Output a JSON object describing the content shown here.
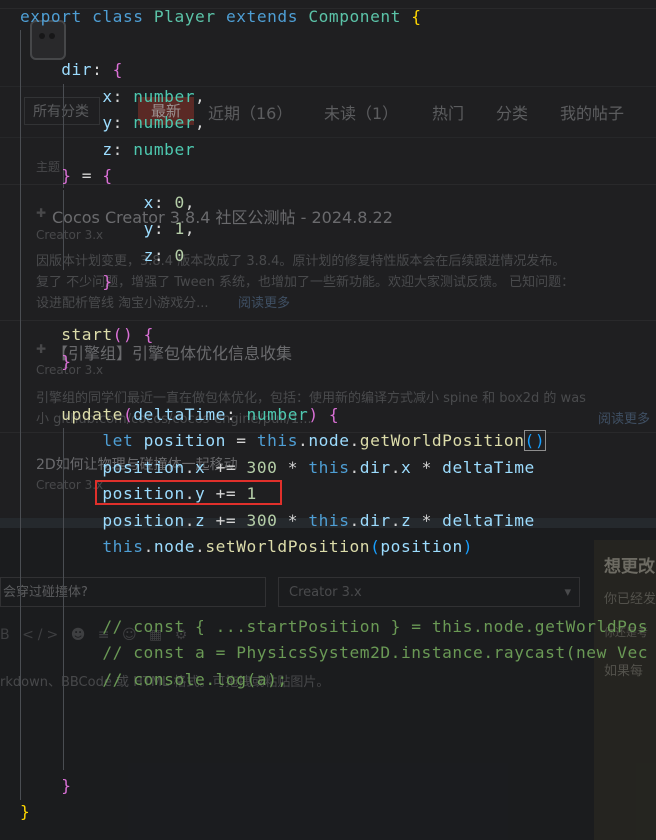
{
  "forum": {
    "category_select": "所有分类",
    "nav": {
      "latest": "最新",
      "recent": "近期（16）",
      "unread": "未读（1）",
      "hot": "热门",
      "categories": "分类",
      "my_posts": "我的帖子"
    },
    "topic_label": "主题",
    "topics": [
      {
        "title": "Cocos Creator 3.8.4 社区公测帖 - 2024.8.22",
        "tag": "Creator 3.x",
        "excerpt_1": "因版本计划变更，3.8.4 版本改成了 3.8.4。原计划的修复特性版本会在后续跟进情况发布。",
        "excerpt_2": "复了 不少问题，增强了 Tween 系统，也增加了一些新功能。欢迎大家测试反馈。 已知问题：",
        "excerpt_3": "设进配析管线 淘宝小游戏分...",
        "read_more": "阅读更多"
      },
      {
        "title": "【引擎组】引擎包体优化信息收集",
        "tag": "Creator 3.x",
        "excerpt_1": "引擎组的同学们最近一直在做包体优化，包括：使用新的编译方式减小 spine 和 box2d 的 was",
        "excerpt_2": "小 github.com/cocos/cocos-engine/pull/1...",
        "read_more": "阅读更多"
      },
      {
        "title": "2D如何让物理与碰撞体一起移动",
        "tag": "Creator 3.x"
      }
    ],
    "composer": {
      "title_value": "会穿过碰撞体?",
      "tag_value": "Creator 3.x",
      "hint": "rkdown、BBCode 或 HTML 格式。可拖拽或粘贴图片。",
      "toolbar_icons": [
        "bold-icon",
        "code-icon",
        "person-icon",
        "list-icon",
        "emoji-icon",
        "calendar-icon",
        "gear-icon"
      ]
    },
    "side": {
      "title": "想更改",
      "line_1": "你已经发",
      "line_2": "你还是考",
      "line_3": "如果每"
    }
  },
  "editor": {
    "lines": [
      {
        "tokens": [
          [
            "kw",
            "export"
          ],
          [
            "op",
            " "
          ],
          [
            "kw",
            "class"
          ],
          [
            "op",
            " "
          ],
          [
            "cls",
            "Player"
          ],
          [
            "op",
            " "
          ],
          [
            "kw",
            "extends"
          ],
          [
            "op",
            " "
          ],
          [
            "cls",
            "Component"
          ],
          [
            "op",
            " "
          ],
          [
            "br",
            "{"
          ]
        ]
      },
      {
        "tokens": []
      },
      {
        "tokens": [
          [
            "op",
            "    "
          ],
          [
            "var",
            "dir"
          ],
          [
            "op",
            ": "
          ],
          [
            "pu",
            "{"
          ]
        ]
      },
      {
        "tokens": [
          [
            "op",
            "        "
          ],
          [
            "var",
            "x"
          ],
          [
            "op",
            ": "
          ],
          [
            "typ",
            "number"
          ],
          [
            "op",
            ","
          ]
        ]
      },
      {
        "tokens": [
          [
            "op",
            "        "
          ],
          [
            "var",
            "y"
          ],
          [
            "op",
            ": "
          ],
          [
            "typ",
            "number"
          ],
          [
            "op",
            ","
          ]
        ]
      },
      {
        "tokens": [
          [
            "op",
            "        "
          ],
          [
            "var",
            "z"
          ],
          [
            "op",
            ": "
          ],
          [
            "typ",
            "number"
          ]
        ]
      },
      {
        "tokens": [
          [
            "op",
            "    "
          ],
          [
            "pu",
            "}"
          ],
          [
            "op",
            " = "
          ],
          [
            "pu",
            "{"
          ]
        ]
      },
      {
        "tokens": [
          [
            "op",
            "            "
          ],
          [
            "var",
            "x"
          ],
          [
            "op",
            ": "
          ],
          [
            "num",
            "0"
          ],
          [
            "op",
            ","
          ]
        ]
      },
      {
        "tokens": [
          [
            "op",
            "            "
          ],
          [
            "var",
            "y"
          ],
          [
            "op",
            ": "
          ],
          [
            "num",
            "1"
          ],
          [
            "op",
            ","
          ]
        ]
      },
      {
        "tokens": [
          [
            "op",
            "            "
          ],
          [
            "var",
            "z"
          ],
          [
            "op",
            ": "
          ],
          [
            "num",
            "0"
          ]
        ]
      },
      {
        "tokens": [
          [
            "op",
            "        "
          ],
          [
            "pu",
            "}"
          ]
        ]
      },
      {
        "tokens": []
      },
      {
        "tokens": [
          [
            "op",
            "    "
          ],
          [
            "fn",
            "start"
          ],
          [
            "pu",
            "()"
          ],
          [
            "op",
            " "
          ],
          [
            "pu",
            "{"
          ]
        ]
      },
      {
        "tokens": [
          [
            "op",
            "    "
          ],
          [
            "pu",
            "}"
          ]
        ]
      },
      {
        "tokens": []
      },
      {
        "tokens": [
          [
            "op",
            "    "
          ],
          [
            "fn",
            "update"
          ],
          [
            "pu",
            "("
          ],
          [
            "var",
            "deltaTime"
          ],
          [
            "op",
            ": "
          ],
          [
            "typ",
            "number"
          ],
          [
            "pu",
            ")"
          ],
          [
            "op",
            " "
          ],
          [
            "pu",
            "{"
          ]
        ]
      },
      {
        "tokens": [
          [
            "op",
            "        "
          ],
          [
            "kw",
            "let"
          ],
          [
            "op",
            " "
          ],
          [
            "var",
            "position"
          ],
          [
            "op",
            " = "
          ],
          [
            "kw",
            "this"
          ],
          [
            "op",
            "."
          ],
          [
            "var",
            "node"
          ],
          [
            "op",
            "."
          ],
          [
            "fn",
            "getWorldPosition"
          ],
          [
            "brb box",
            "()"
          ]
        ]
      },
      {
        "tokens": [
          [
            "op",
            "        "
          ],
          [
            "var",
            "position"
          ],
          [
            "op",
            "."
          ],
          [
            "var",
            "x"
          ],
          [
            "op",
            " += "
          ],
          [
            "num",
            "300"
          ],
          [
            "op",
            " * "
          ],
          [
            "kw",
            "this"
          ],
          [
            "op",
            "."
          ],
          [
            "var",
            "dir"
          ],
          [
            "op",
            "."
          ],
          [
            "var",
            "x"
          ],
          [
            "op",
            " * "
          ],
          [
            "var",
            "deltaTime"
          ]
        ]
      },
      {
        "tokens": [
          [
            "op",
            "        "
          ],
          [
            "var",
            "position"
          ],
          [
            "op",
            "."
          ],
          [
            "var",
            "y"
          ],
          [
            "op",
            " += "
          ],
          [
            "num",
            "1"
          ]
        ]
      },
      {
        "tokens": [
          [
            "op",
            "        "
          ],
          [
            "var",
            "position"
          ],
          [
            "op",
            "."
          ],
          [
            "var",
            "z"
          ],
          [
            "op",
            " += "
          ],
          [
            "num",
            "300"
          ],
          [
            "op",
            " * "
          ],
          [
            "kw",
            "this"
          ],
          [
            "op",
            "."
          ],
          [
            "var",
            "dir"
          ],
          [
            "op",
            "."
          ],
          [
            "var",
            "z"
          ],
          [
            "op",
            " * "
          ],
          [
            "var",
            "deltaTime"
          ]
        ]
      },
      {
        "tokens": [
          [
            "op",
            "        "
          ],
          [
            "kw",
            "this"
          ],
          [
            "op",
            "."
          ],
          [
            "var",
            "node"
          ],
          [
            "op",
            "."
          ],
          [
            "fn",
            "setWorldPosition"
          ],
          [
            "brb",
            "("
          ],
          [
            "var",
            "position"
          ],
          [
            "brb",
            ")"
          ]
        ]
      },
      {
        "tokens": []
      },
      {
        "tokens": []
      },
      {
        "tokens": [
          [
            "op",
            "        "
          ],
          [
            "com",
            "// const { ...startPosition } = this.node.getWorldPos"
          ]
        ]
      },
      {
        "tokens": [
          [
            "op",
            "        "
          ],
          [
            "com",
            "// const a = PhysicsSystem2D.instance.raycast(new Vec"
          ]
        ]
      },
      {
        "tokens": [
          [
            "op",
            "        "
          ],
          [
            "com",
            "// console.log(a);"
          ]
        ]
      },
      {
        "tokens": []
      },
      {
        "tokens": []
      },
      {
        "tokens": []
      },
      {
        "tokens": [
          [
            "op",
            "    "
          ],
          [
            "pu",
            "}"
          ]
        ]
      },
      {
        "tokens": [
          [
            "br",
            "}"
          ]
        ]
      }
    ],
    "highlighted_line": 18,
    "colors": {
      "keyword": "#4e9ed4",
      "class": "#5bc3a8",
      "brace": "#ffd700",
      "nested_brace": "#da70d6",
      "variable": "#9cdcfe",
      "type": "#4ec9b0",
      "function": "#dcdcaa",
      "number": "#b5cea8",
      "comment": "#6a9955",
      "highlight_box": "#e0302b"
    }
  }
}
